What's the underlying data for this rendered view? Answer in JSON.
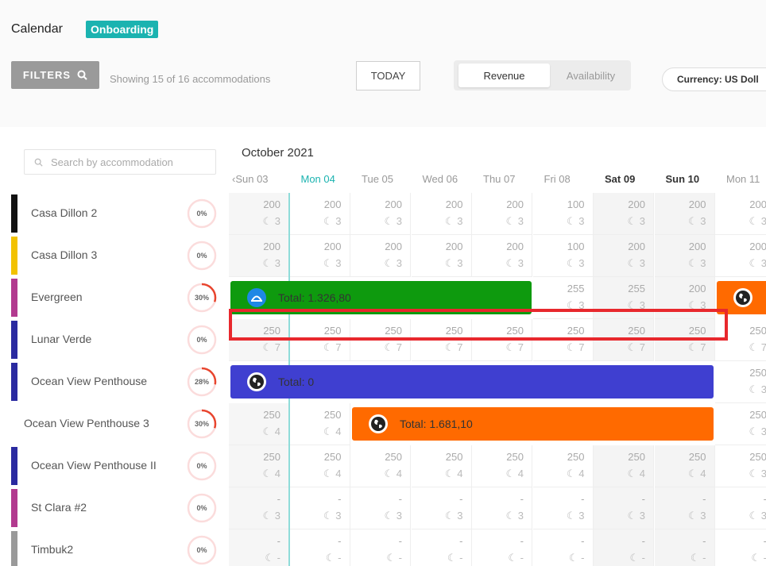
{
  "header": {
    "title": "Calendar",
    "badge": "Onboarding",
    "filters_label": "FILTERS",
    "showing_text": "Showing 15 of 16 accommodations",
    "today_label": "TODAY",
    "view_toggle": {
      "active": "Revenue",
      "inactive": "Availability"
    },
    "currency_label": "Currency: US Doll"
  },
  "search": {
    "placeholder": "Search by accommodation"
  },
  "accommodations": [
    {
      "name": "Casa Dillon 2",
      "percent": "0%",
      "color": "#111111"
    },
    {
      "name": "Casa Dillon 3",
      "percent": "0%",
      "color": "#f2c200"
    },
    {
      "name": "Evergreen",
      "percent": "30%",
      "color": "#b23a8f"
    },
    {
      "name": "Lunar Verde",
      "percent": "0%",
      "color": "#2a2aa0"
    },
    {
      "name": "Ocean View Penthouse",
      "percent": "28%",
      "color": "#2a2aa0"
    },
    {
      "name": "Ocean View Penthouse 3",
      "percent": "30%",
      "color": ""
    },
    {
      "name": "Ocean View Penthouse II",
      "percent": "0%",
      "color": "#2a2aa0"
    },
    {
      "name": "St Clara #2",
      "percent": "0%",
      "color": "#b23a8f"
    },
    {
      "name": "Timbuk2",
      "percent": "0%",
      "color": "#9a9a9a"
    }
  ],
  "calendar": {
    "month": "October 2021",
    "days": [
      "Sun 03",
      "Mon 04",
      "Tue 05",
      "Wed 06",
      "Thu 07",
      "Fri 08",
      "Sat 09",
      "Sun 10",
      "Mon 11"
    ],
    "grid": [
      [
        [
          "200",
          "3"
        ],
        [
          "200",
          "3"
        ],
        [
          "200",
          "3"
        ],
        [
          "200",
          "3"
        ],
        [
          "200",
          "3"
        ],
        [
          "100",
          "3"
        ],
        [
          "200",
          "3"
        ],
        [
          "200",
          "3"
        ],
        [
          "200",
          "3"
        ]
      ],
      [
        [
          "200",
          "3"
        ],
        [
          "200",
          "3"
        ],
        [
          "200",
          "3"
        ],
        [
          "200",
          "3"
        ],
        [
          "200",
          "3"
        ],
        [
          "100",
          "3"
        ],
        [
          "200",
          "3"
        ],
        [
          "200",
          "3"
        ],
        [
          "200",
          "3"
        ]
      ],
      [
        null,
        null,
        null,
        null,
        null,
        [
          "255",
          "3"
        ],
        [
          "255",
          "3"
        ],
        [
          "200",
          "3"
        ],
        null
      ],
      [
        [
          "250",
          "7"
        ],
        [
          "250",
          "7"
        ],
        [
          "250",
          "7"
        ],
        [
          "250",
          "7"
        ],
        [
          "250",
          "7"
        ],
        [
          "250",
          "7"
        ],
        [
          "250",
          "7"
        ],
        [
          "250",
          "7"
        ],
        [
          "250",
          "7"
        ]
      ],
      [
        null,
        null,
        null,
        null,
        null,
        null,
        null,
        null,
        [
          "250",
          "3"
        ]
      ],
      [
        [
          "250",
          "4"
        ],
        [
          "250",
          "4"
        ],
        null,
        null,
        null,
        null,
        null,
        null,
        [
          "250",
          "3"
        ]
      ],
      [
        [
          "250",
          "4"
        ],
        [
          "250",
          "4"
        ],
        [
          "250",
          "4"
        ],
        [
          "250",
          "4"
        ],
        [
          "250",
          "4"
        ],
        [
          "250",
          "4"
        ],
        [
          "250",
          "4"
        ],
        [
          "250",
          "4"
        ],
        [
          "250",
          "3"
        ]
      ],
      [
        [
          "-",
          "3"
        ],
        [
          "-",
          "3"
        ],
        [
          "-",
          "3"
        ],
        [
          "-",
          "3"
        ],
        [
          "-",
          "3"
        ],
        [
          "-",
          "3"
        ],
        [
          "-",
          "3"
        ],
        [
          "-",
          "3"
        ],
        [
          "-",
          "3"
        ]
      ],
      [
        [
          "-",
          "-"
        ],
        [
          "-",
          "-"
        ],
        [
          "-",
          "-"
        ],
        [
          "-",
          "-"
        ],
        [
          "-",
          "-"
        ],
        [
          "-",
          "-"
        ],
        [
          "-",
          "-"
        ],
        [
          "-",
          "-"
        ],
        [
          "-",
          "-"
        ]
      ]
    ],
    "bookings": [
      {
        "label": "Total: 1.326,80",
        "color": "#0e9a0e",
        "icon": "airbnb-icon",
        "row": 2,
        "start": 0,
        "span": 5
      },
      {
        "label": "",
        "color": "#ff6a00",
        "icon": "globe-icon",
        "row": 2,
        "start": 8,
        "span": 1
      },
      {
        "label": "Total: 0",
        "color": "#3f3fd0",
        "icon": "globe-icon",
        "row": 4,
        "start": 0,
        "span": 8
      },
      {
        "label": "Total: 1.681,10",
        "color": "#ff6a00",
        "icon": "globe-icon",
        "row": 5,
        "start": 2,
        "span": 6
      }
    ]
  }
}
